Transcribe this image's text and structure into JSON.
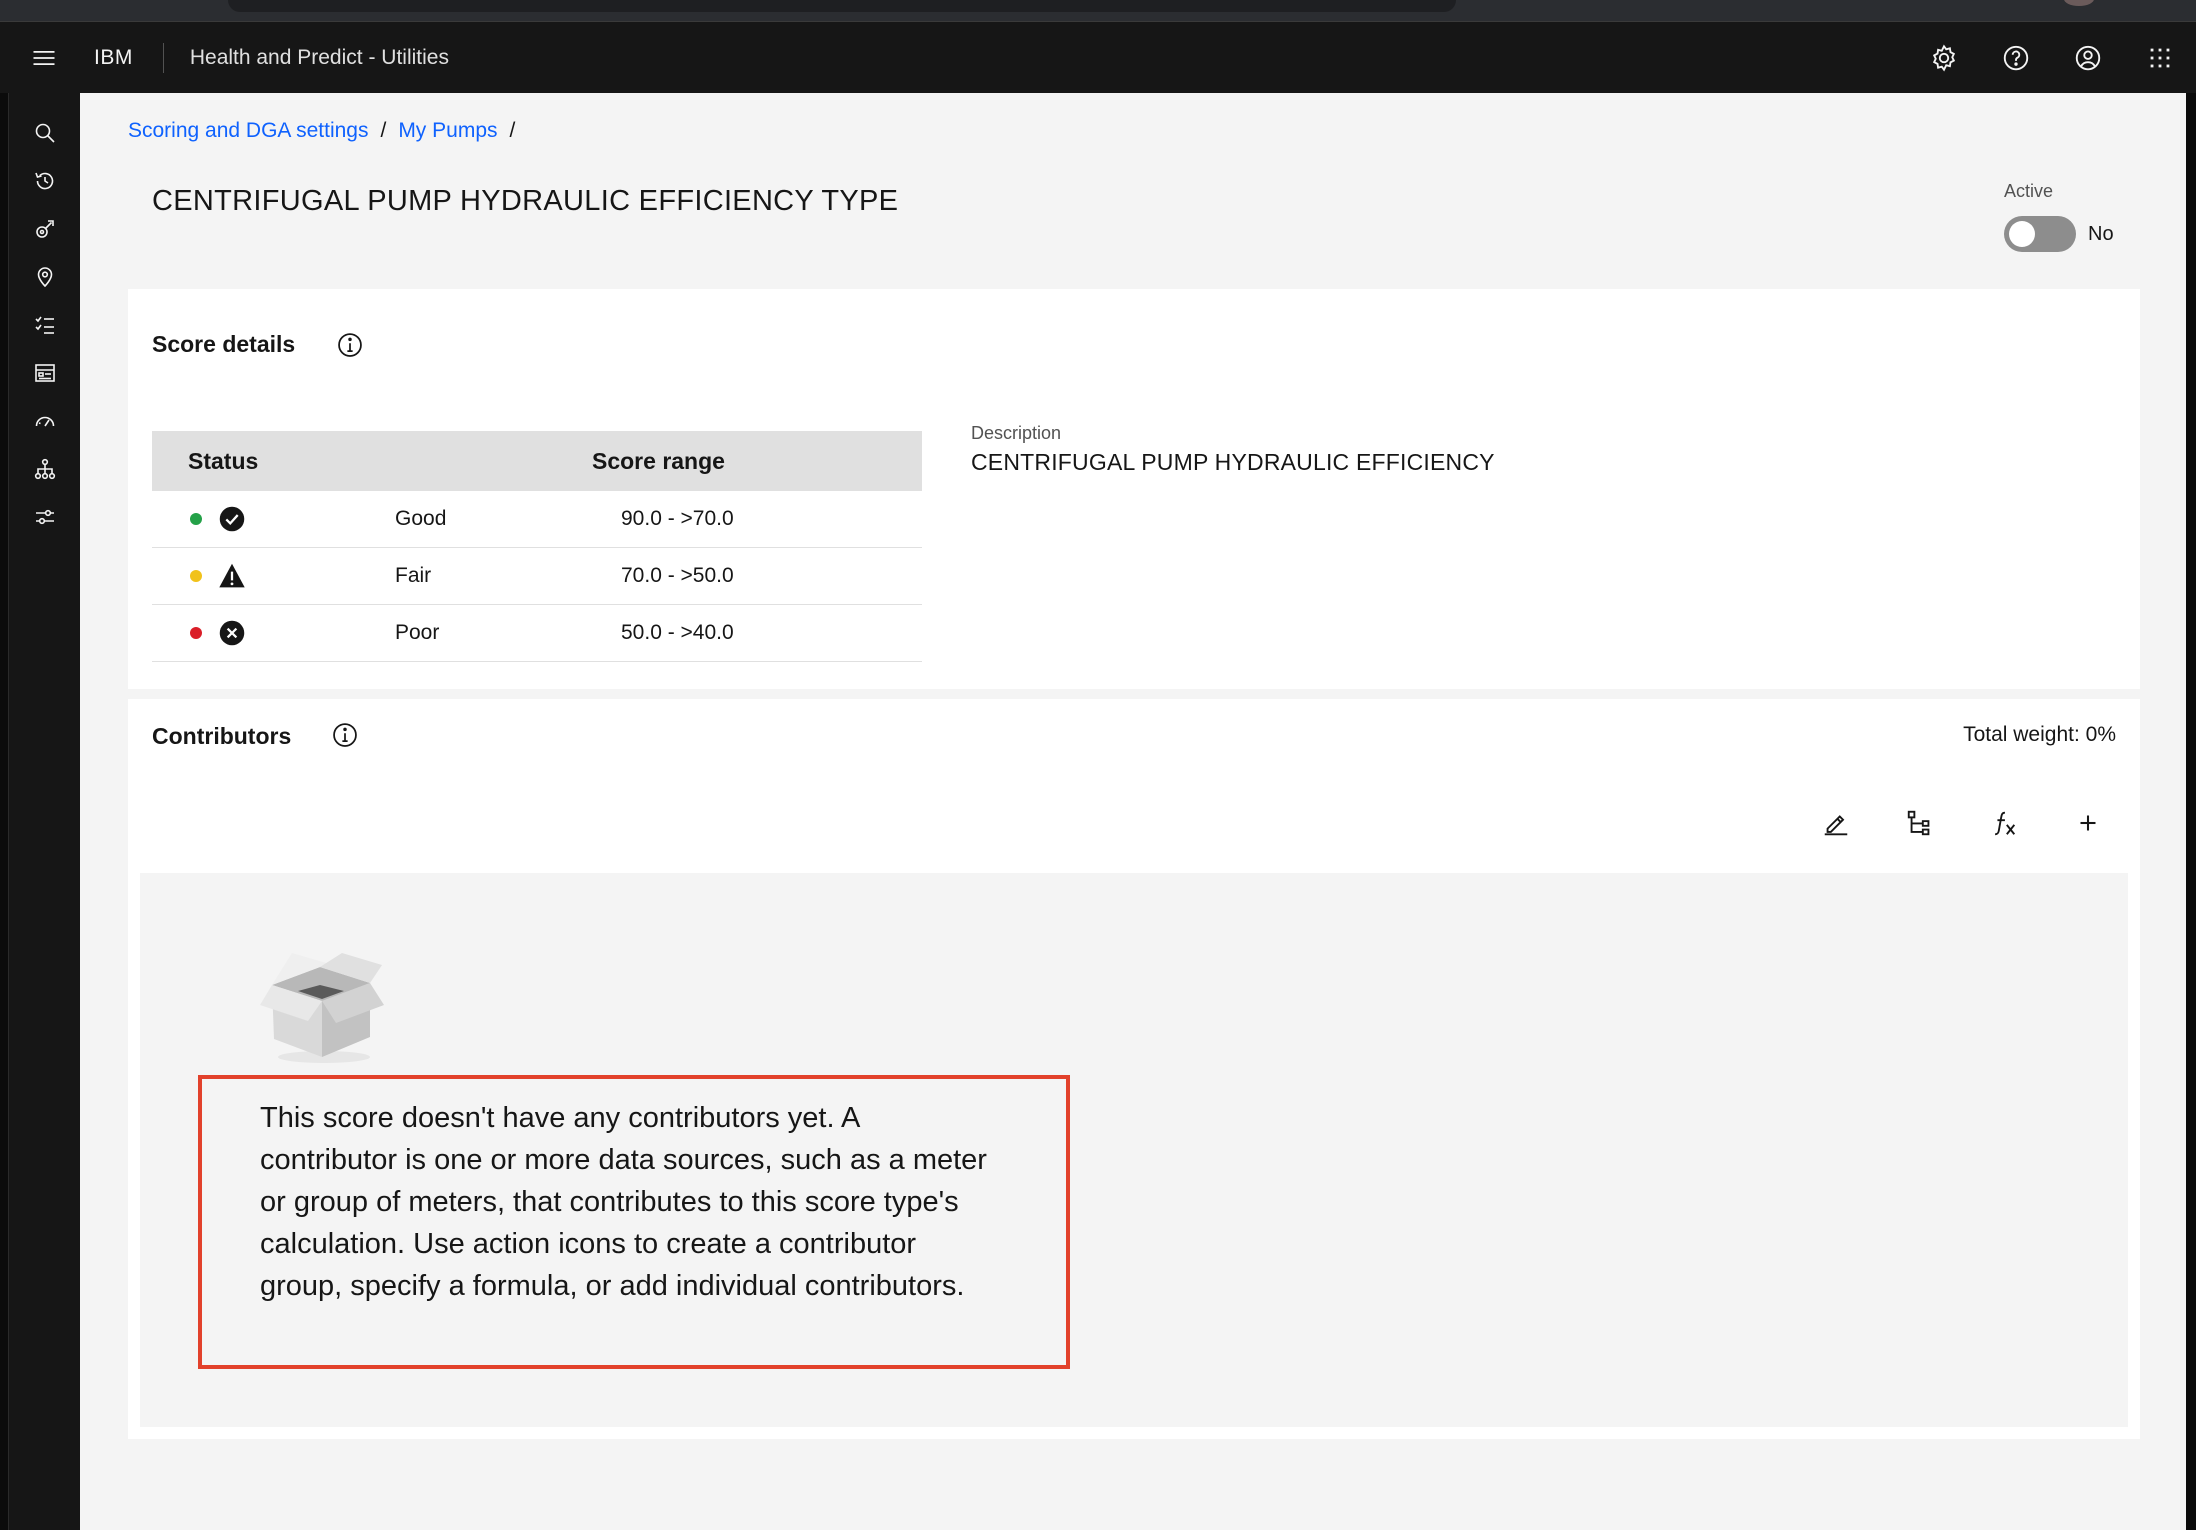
{
  "header": {
    "brand": "IBM",
    "app_title": "Health and Predict - Utilities",
    "actions": [
      "settings-icon",
      "help-icon",
      "user-icon",
      "app-switcher-icon"
    ]
  },
  "rail": {
    "icons": [
      "search-icon",
      "history-icon",
      "asset-icon",
      "location-icon",
      "tasks-icon",
      "dashboard-icon",
      "meter-icon",
      "hierarchy-icon",
      "settings-sliders-icon"
    ]
  },
  "breadcrumb": {
    "items": [
      "Scoring and DGA settings",
      "My Pumps"
    ],
    "separator": "/"
  },
  "page": {
    "title": "CENTRIFUGAL PUMP HYDRAULIC EFFICIENCY TYPE",
    "active_label": "Active",
    "active_value": "No",
    "active_on": false
  },
  "score_details": {
    "title": "Score details",
    "columns": [
      "Status",
      "Score range"
    ],
    "rows": [
      {
        "status": "Good",
        "range": "90.0 - >70.0",
        "color": "#24a148",
        "icon": "checkmark-icon"
      },
      {
        "status": "Fair",
        "range": "70.0 - >50.0",
        "color": "#f1c21b",
        "icon": "warning-icon"
      },
      {
        "status": "Poor",
        "range": "50.0 - >40.0",
        "color": "#da1e28",
        "icon": "error-icon"
      }
    ],
    "description_label": "Description",
    "description_value": "CENTRIFUGAL PUMP HYDRAULIC EFFICIENCY"
  },
  "contributors": {
    "title": "Contributors",
    "total_weight": "Total weight: 0%",
    "tools": [
      "edit-icon",
      "contributor-group-icon",
      "formula-icon",
      "add-icon"
    ],
    "empty_message": "This score doesn't have any contributors yet. A contributor is one or more data sources, such as a meter or group of meters, that contributes to this score type's calculation. Use action icons to create a contributor group, specify a formula, or add individual contributors."
  },
  "colors": {
    "accent": "#0f62fe",
    "highlight_border": "#e2412b"
  }
}
